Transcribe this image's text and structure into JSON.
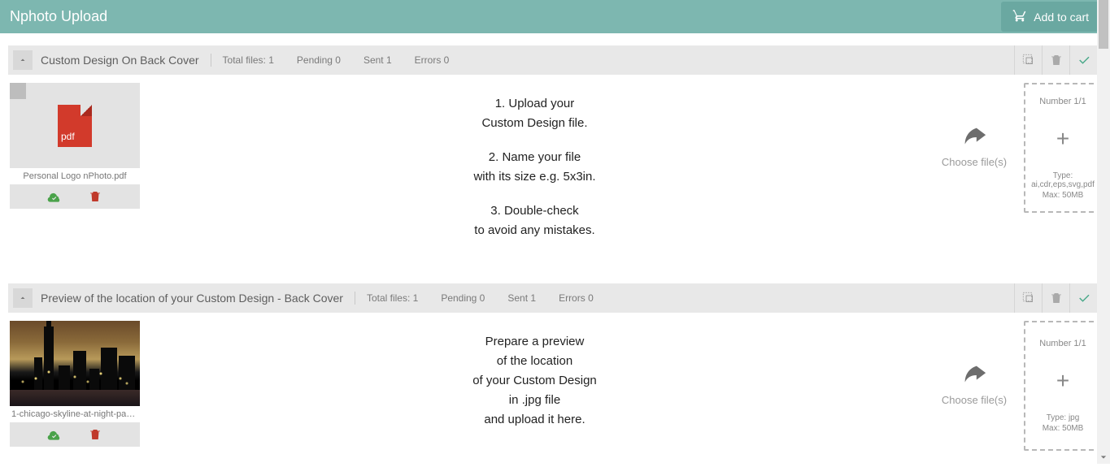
{
  "app": {
    "title": "Nphoto Upload",
    "add_to_cart": "Add to cart"
  },
  "sections": [
    {
      "title": "Custom Design On Back Cover",
      "stats": {
        "total_label": "Total files: 1",
        "pending": "Pending 0",
        "sent": "Sent 1",
        "errors": "Errors 0"
      },
      "tile": {
        "kind": "pdf",
        "ext_label": "pdf",
        "filename": "Personal Logo nPhoto.pdf"
      },
      "instructions": [
        "1. Upload your\nCustom Design file.",
        "2. Name your file\nwith its size e.g. 5x3in.",
        "3. Double-check\nto avoid any mistakes."
      ],
      "choose_label": "Choose file(s)",
      "dropzone": {
        "number_label": "Number 1/1",
        "type_label": "Type:",
        "type_value": "ai,cdr,eps,svg,pdf",
        "max_label": "Max: 50MB"
      }
    },
    {
      "title": "Preview of the location of your Custom Design - Back Cover",
      "stats": {
        "total_label": "Total files: 1",
        "pending": "Pending 0",
        "sent": "Sent 1",
        "errors": "Errors 0"
      },
      "tile": {
        "kind": "image",
        "filename": "1-chicago-skyline-at-night-paul-velg..."
      },
      "instructions_single": "Prepare a preview\nof the location\nof your Custom Design\nin .jpg file\nand upload it here.",
      "choose_label": "Choose file(s)",
      "dropzone": {
        "number_label": "Number 1/1",
        "type_label": "Type: jpg",
        "type_value": "",
        "max_label": "Max: 50MB"
      }
    }
  ]
}
